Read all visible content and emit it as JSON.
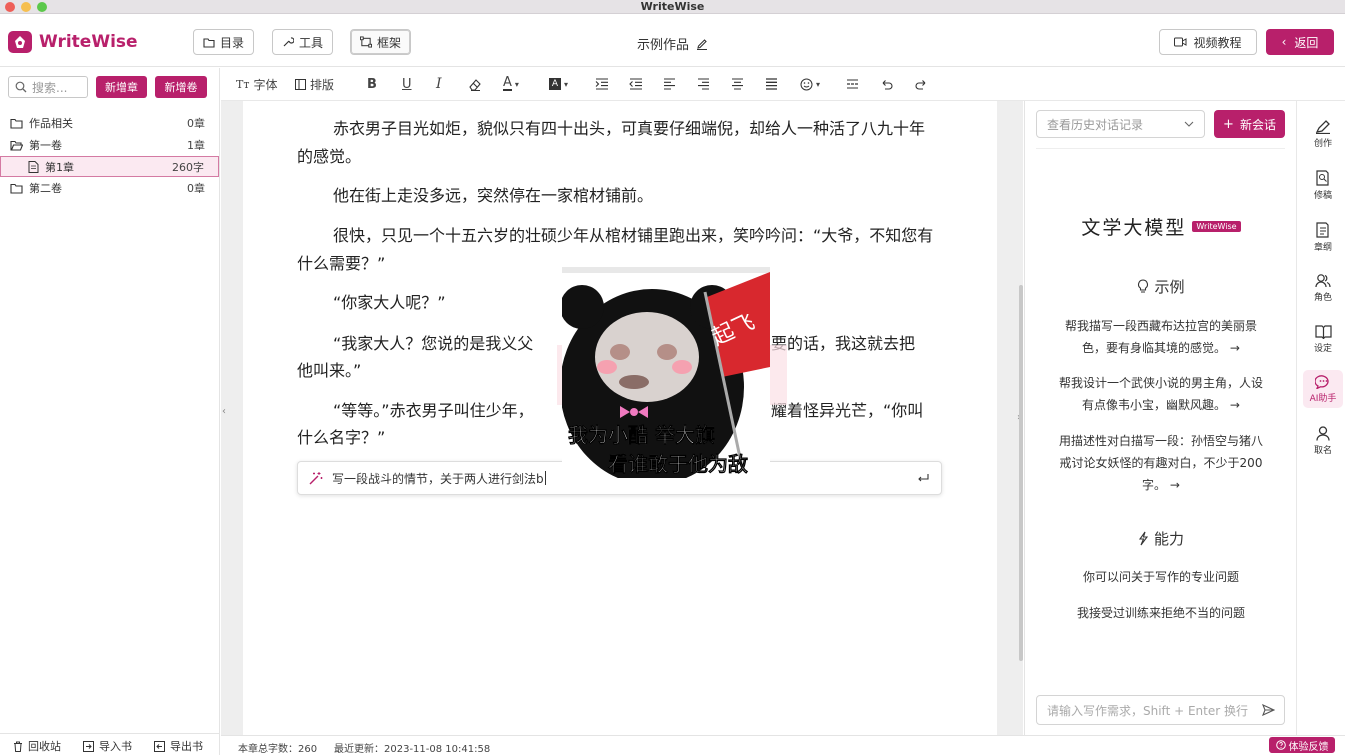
{
  "window": {
    "title": "WriteWise"
  },
  "header": {
    "logo_text": "WriteWise",
    "btn_toc": "目录",
    "btn_tools": "工具",
    "btn_frame": "框架",
    "doc_title": "示例作品",
    "btn_video": "视频教程",
    "btn_back": "返回"
  },
  "sidebar": {
    "search_placeholder": "搜索...",
    "btn_new_chapter": "新增章",
    "btn_new_volume": "新增卷",
    "tree": [
      {
        "label": "作品相关",
        "count": "0章"
      },
      {
        "label": "第一卷",
        "count": "1章"
      },
      {
        "label": "第1章",
        "count": "260字"
      },
      {
        "label": "第二卷",
        "count": "0章"
      }
    ],
    "footer": {
      "recycle": "回收站",
      "import": "导入书",
      "export": "导出书"
    }
  },
  "toolbar": {
    "font": "字体",
    "layout": "排版"
  },
  "editor": {
    "paragraphs": [
      "赤衣男子目光如炬，貌似只有四十出头，可真要仔细端倪，却给人一种活了八九十年的感觉。",
      "他在街上走没多远，突然停在一家棺材铺前。",
      "很快，只见一个十五六岁的壮硕少年从棺材铺里跑出来，笑吟吟问：“大爷，不知您有什么需要？”",
      "“你家大人呢？”",
      "“我家大人？您说的是我义父吗？他在后院忙着呢，您要是有需要的话，我这就去把他叫来。”",
      "“等等。”赤衣男子叫住少年，眼中闪过一丝意味，目光闪耀着怪异光芒，“你叫什么名字？”"
    ],
    "p4_visible": [
      "“我家大人？您说的是我义父",
      "要的话，我这就去把",
      "他叫来。”"
    ],
    "p5_visible": [
      "“等等。”赤衣男子叫住少年，",
      "耀着怪异光芒，“你叫",
      "什么名字？”"
    ],
    "ai_input": "写一段战斗的情节，关于两人进行剑法b",
    "meme_caption_1": "我为小酷 举大旗",
    "meme_caption_2": "看谁敢于他为敌",
    "meme_flag": "起飞"
  },
  "right_panel": {
    "history_placeholder": "查看历史对话记录",
    "new_chat": "新会话",
    "model_title": "文学大模型",
    "model_badge": "WriteWise",
    "examples_title": "示例",
    "examples": [
      [
        "帮我描写一段西藏布达拉宫的美丽景",
        "色，要有身临其境的感觉。"
      ],
      [
        "帮我设计一个武侠小说的男主角，人设",
        "有点像韦小宝，幽默风趣。"
      ],
      [
        "用描述性对白描写一段：孙悟空与猪八",
        "戒讨论女妖怪的有趣对白，不少于200",
        "字。"
      ]
    ],
    "ability_title": "能力",
    "abilities": [
      "你可以问关于写作的专业问题",
      "我接受过训练来拒绝不当的问题"
    ],
    "chat_placeholder": "请输入写作需求，Shift + Enter 换行"
  },
  "iconbar": [
    {
      "label": "创作",
      "icon": "brush-icon"
    },
    {
      "label": "修稿",
      "icon": "doc-search-icon"
    },
    {
      "label": "章纲",
      "icon": "doc-outline-icon"
    },
    {
      "label": "角色",
      "icon": "people-icon"
    },
    {
      "label": "设定",
      "icon": "book-icon"
    },
    {
      "label": "AI助手",
      "icon": "chat-icon"
    },
    {
      "label": "取名",
      "icon": "person-icon"
    }
  ],
  "status": {
    "word_count": "本章总字数：260",
    "last_update": "最近更新：2023-11-08 10:41:58",
    "feedback": "体验反馈"
  },
  "colors": {
    "accent": "#b8206b",
    "traffic": [
      "#ee5f58",
      "#f6bf4f",
      "#5cc84b"
    ]
  }
}
